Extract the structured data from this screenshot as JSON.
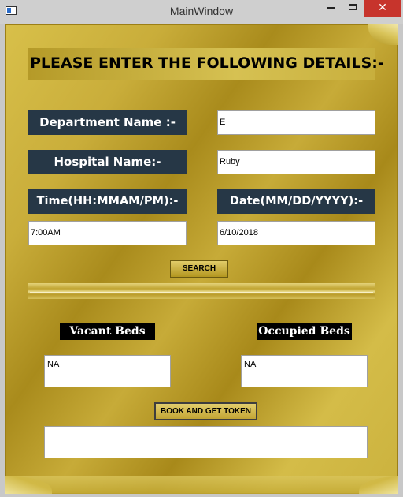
{
  "window": {
    "title": "MainWindow",
    "minimize_glyph": "",
    "maximize_glyph": "",
    "close_glyph": "✕"
  },
  "form": {
    "heading": "PLEASE ENTER THE FOLLOWING DETAILS:-",
    "department_label": "Department Name :-",
    "department_value": "E",
    "hospital_label": "Hospital Name:-",
    "hospital_value": "Ruby",
    "time_label": "Time(HH:MMAM/PM):-",
    "time_value": "7:00AM",
    "date_label": "Date(MM/DD/YYYY):-",
    "date_value": "6/10/2018",
    "search_label": "SEARCH"
  },
  "beds": {
    "vacant_label": "Vacant Beds",
    "vacant_value": "NA",
    "occupied_label": "Occupied Beds",
    "occupied_value": "NA"
  },
  "booking": {
    "button_label": "BOOK AND GET TOKEN",
    "token_value": ""
  },
  "colors": {
    "label_bg": "#263746",
    "panel_gold": "#c9ad3a",
    "close_red": "#c7342c"
  }
}
